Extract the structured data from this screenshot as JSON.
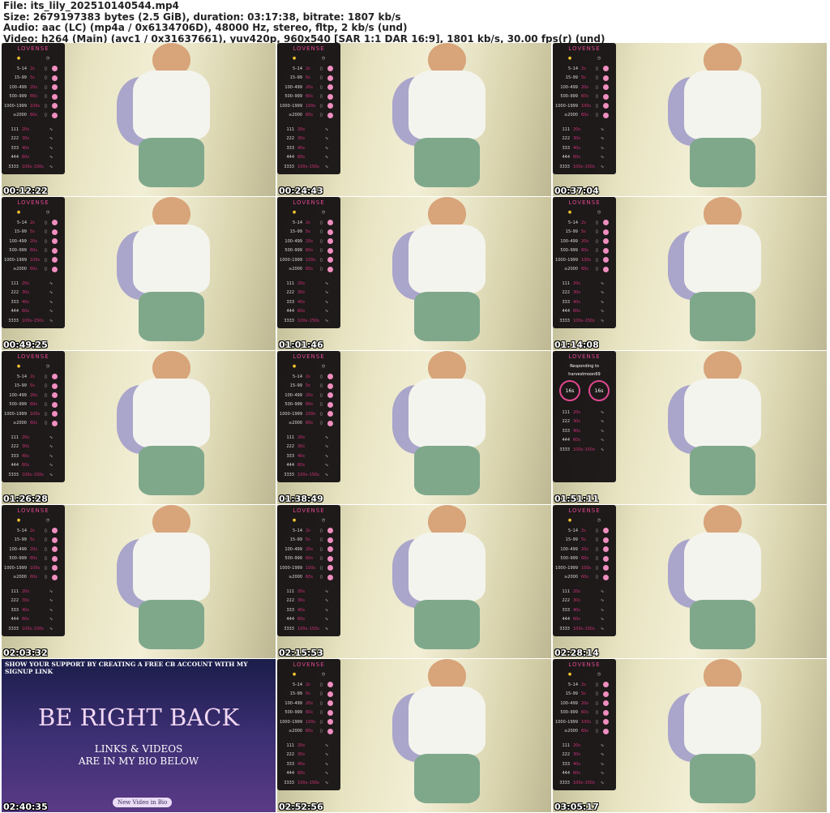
{
  "header": {
    "lines": [
      "File: its_lily_202510140544.mp4",
      "Size: 2679197383 bytes (2.5 GiB), duration: 03:17:38, bitrate: 1807 kb/s",
      "Audio: aac (LC) (mp4a / 0x6134706D), 48000 Hz, stereo, fltp, 2 kb/s (und)",
      "Video: h264 (Main) (avc1 / 0x31637661), yuv420p, 960x540 [SAR 1:1 DAR 16:9], 1801 kb/s, 30.00 fps(r) (und)"
    ]
  },
  "panel": {
    "brand": "LOVENSE",
    "levels": [
      [
        "5–14",
        "2s"
      ],
      [
        "15–99",
        "5s"
      ],
      [
        "100–499",
        "20s"
      ],
      [
        "500–999",
        "60s"
      ],
      [
        "1000–1999",
        "100s"
      ],
      [
        "≥2000",
        "60s"
      ]
    ],
    "patterns": [
      [
        "111",
        "20s"
      ],
      [
        "222",
        "30s"
      ],
      [
        "333",
        "40s"
      ],
      [
        "444",
        "60s"
      ],
      [
        "3333",
        "100s–150s"
      ]
    ]
  },
  "responding": {
    "label": "Responding to",
    "user": "harvestmoon69",
    "timers": [
      "16s",
      "16s"
    ]
  },
  "brb": {
    "top": "SHOW YOUR SUPPORT BY CREATING A FREE CB ACCOUNT WITH MY SIGNUP LINK",
    "title": "BE RIGHT BACK",
    "sub1": "LINKS & VIDEOS",
    "sub2": "ARE IN MY BIO BELOW",
    "button": "New Video in Bio"
  },
  "thumbs": [
    {
      "time": "00:12:22",
      "type": "panel"
    },
    {
      "time": "00:24:43",
      "type": "panel"
    },
    {
      "time": "00:37:04",
      "type": "panel"
    },
    {
      "time": "00:49:25",
      "type": "panel"
    },
    {
      "time": "01:01:46",
      "type": "panel"
    },
    {
      "time": "01:14:08",
      "type": "panel"
    },
    {
      "time": "01:26:28",
      "type": "panel"
    },
    {
      "time": "01:38:49",
      "type": "panel"
    },
    {
      "time": "01:51:11",
      "type": "responding"
    },
    {
      "time": "02:03:32",
      "type": "panel"
    },
    {
      "time": "02:15:53",
      "type": "panel"
    },
    {
      "time": "02:28:14",
      "type": "panel"
    },
    {
      "time": "02:40:35",
      "type": "brb"
    },
    {
      "time": "02:52:56",
      "type": "panel"
    },
    {
      "time": "03:05:17",
      "type": "panel"
    }
  ]
}
